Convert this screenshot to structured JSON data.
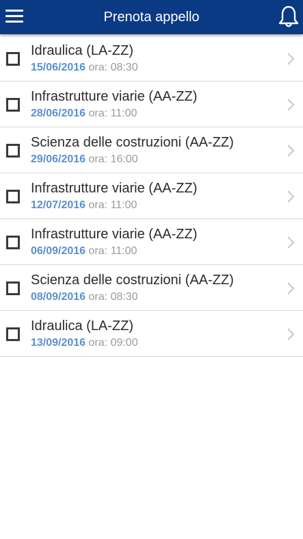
{
  "header": {
    "title": "Prenota appello",
    "menu_icon": "hamburger-menu-icon",
    "bell_icon": "bell-icon",
    "background_color": "#0a3a84"
  },
  "colors": {
    "date": "#5b8fd0",
    "time": "#9a9a9a",
    "title": "#2b2b2b"
  },
  "exams": [
    {
      "name": "Idraulica (LA-ZZ)",
      "date": "15/06/2016",
      "time_label": "ora:",
      "time": "08:30"
    },
    {
      "name": "Infrastrutture viarie (AA-ZZ)",
      "date": "28/06/2016",
      "time_label": "ora:",
      "time": "11:00"
    },
    {
      "name": "Scienza delle costruzioni (AA-ZZ)",
      "date": "29/06/2016",
      "time_label": "ora:",
      "time": "16:00"
    },
    {
      "name": "Infrastrutture viarie (AA-ZZ)",
      "date": "12/07/2016",
      "time_label": "ora:",
      "time": "11:00"
    },
    {
      "name": "Infrastrutture viarie (AA-ZZ)",
      "date": "06/09/2016",
      "time_label": "ora:",
      "time": "11:00"
    },
    {
      "name": "Scienza delle costruzioni (AA-ZZ)",
      "date": "08/09/2016",
      "time_label": "ora:",
      "time": "08:30"
    },
    {
      "name": "Idraulica (LA-ZZ)",
      "date": "13/09/2016",
      "time_label": "ora:",
      "time": "09:00"
    }
  ]
}
